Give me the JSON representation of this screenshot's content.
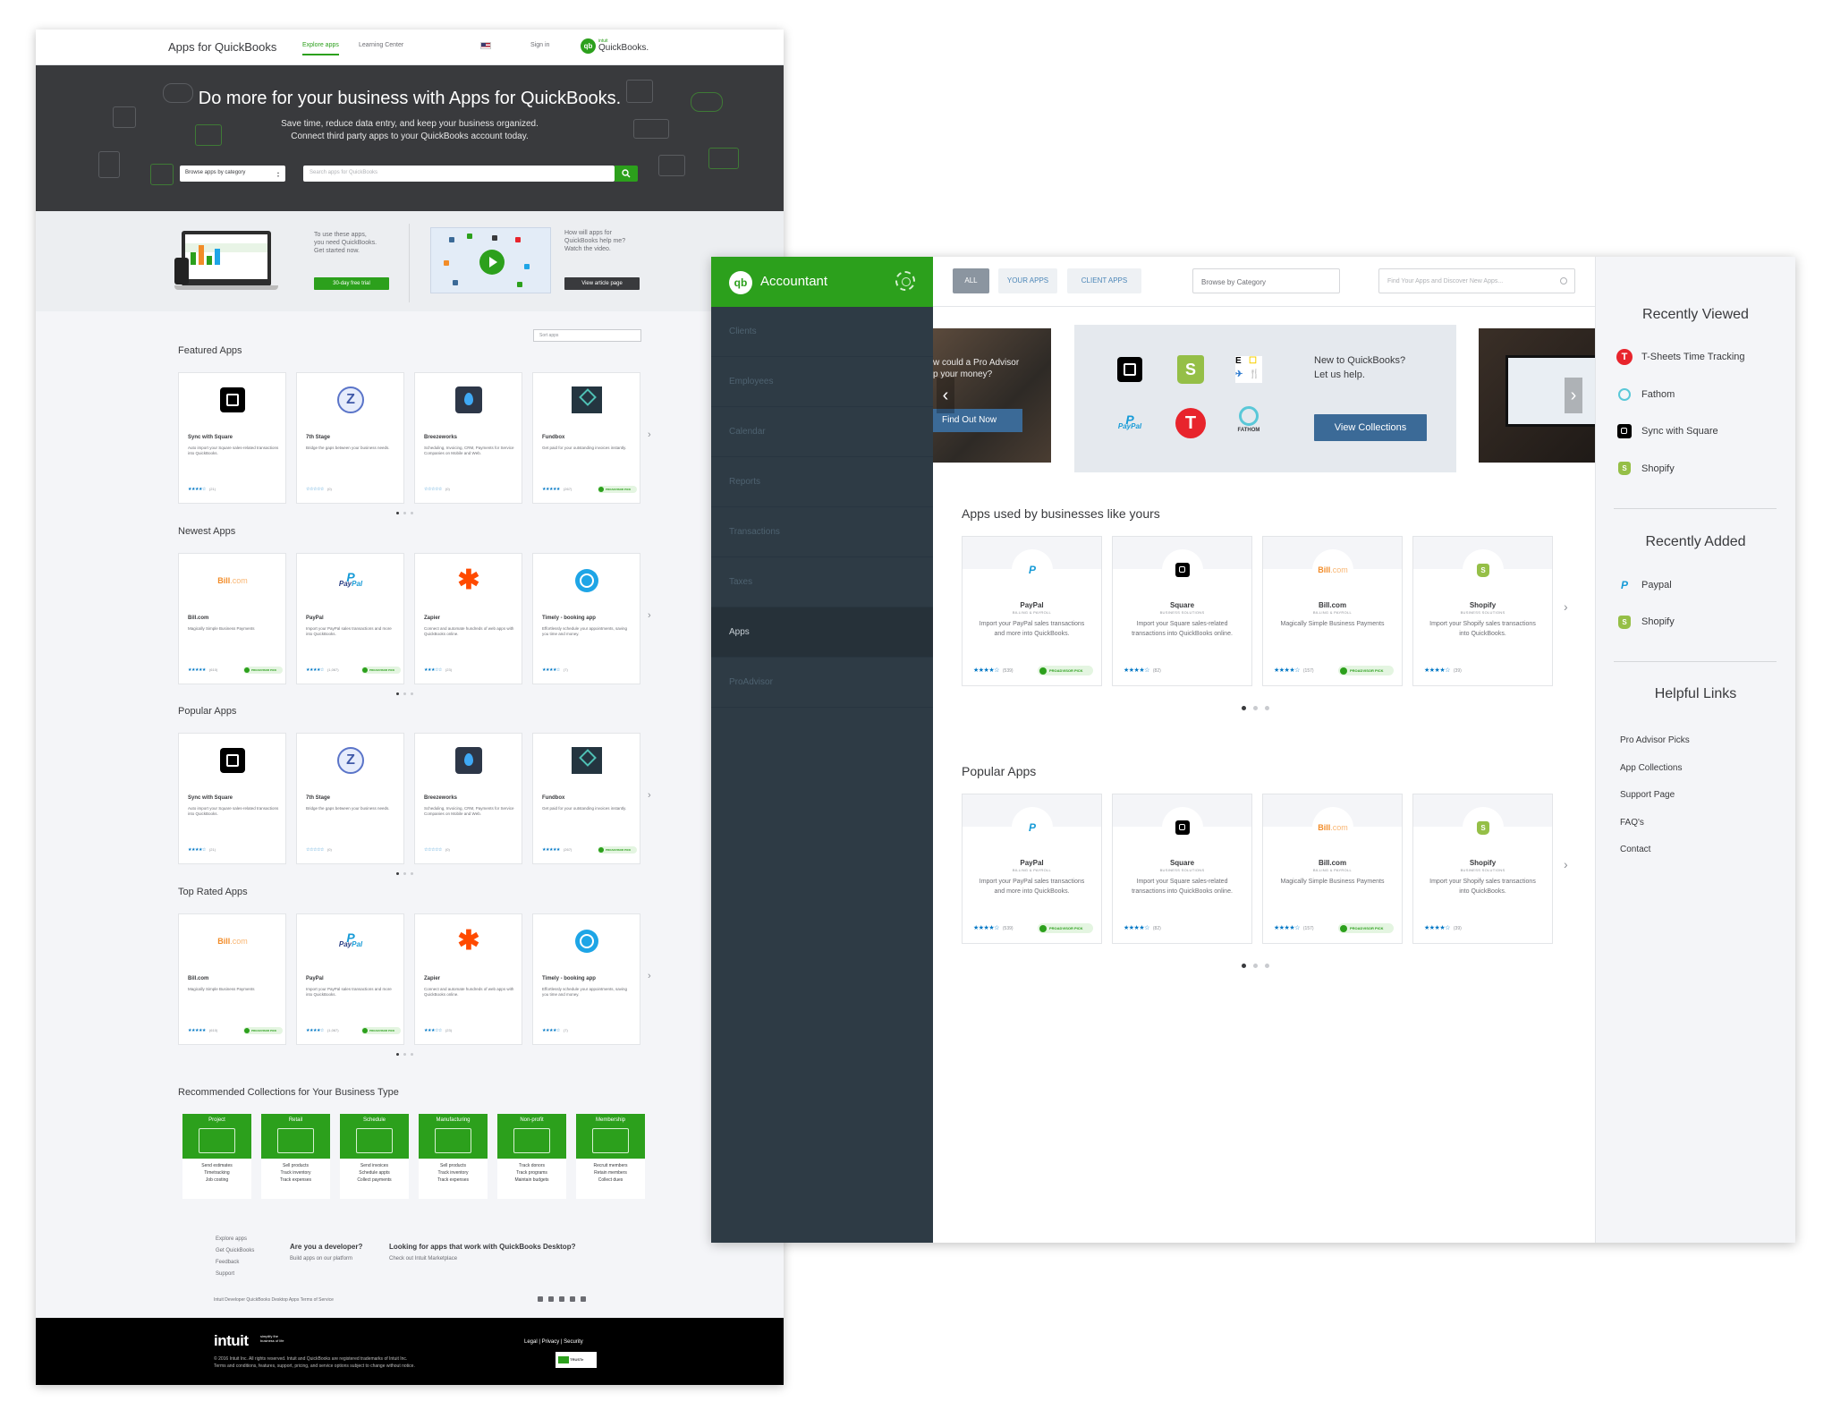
{
  "left": {
    "brand": "Apps for QuickBooks",
    "nav": [
      "Explore apps",
      "Learning Center"
    ],
    "sign_in": "Sign in",
    "qb_logo_top": "intuit",
    "qb_logo": "QuickBooks.",
    "hero": {
      "title": "Do more for your business with Apps for QuickBooks.",
      "subtitle_1": "Save time, reduce data entry, and keep your business organized.",
      "subtitle_2": "Connect third party apps to your QuickBooks account today.",
      "category_select": "Browse apps by category",
      "search_placeholder": "Search apps for QuickBooks"
    },
    "promo": {
      "text_1": "To use these apps,",
      "text_2": "you need QuickBooks.",
      "text_3": "Get started now.",
      "trial_button": "30-day free trial",
      "video_text_1": "How will apps for",
      "video_text_2": "QuickBooks help me?",
      "video_text_3": "Watch the video.",
      "article_button": "View article page"
    },
    "sort_select": "Sort apps",
    "pa_pill": "PROADVISOR PICK",
    "sections": [
      {
        "title": "Featured Apps",
        "cards": [
          {
            "name": "Sync with Square",
            "desc": "Auto import your Square sales-related transactions into QuickBooks.",
            "stars": "★★★★☆",
            "count": "(21)",
            "logo": "square-logo",
            "pa": false
          },
          {
            "name": "7th Stage",
            "desc": "Bridge the gaps between your business needs.",
            "stars": "☆☆☆☆☆",
            "count": "(0)",
            "logo": "seventh-stage-logo",
            "pa": false
          },
          {
            "name": "Breezeworks",
            "desc": "Scheduling, Invoicing, CRM, Payments for Service Companies on Mobile and Web.",
            "stars": "☆☆☆☆☆",
            "count": "(0)",
            "logo": "breezeworks-logo",
            "pa": false
          },
          {
            "name": "Fundbox",
            "desc": "Get paid for your outstanding invoices instantly.",
            "stars": "★★★★★",
            "count": "(267)",
            "logo": "fundbox-logo",
            "pa": true
          }
        ]
      },
      {
        "title": "Newest Apps",
        "cards": [
          {
            "name": "Bill.com",
            "desc": "Magically Simple Business Payments",
            "stars": "★★★★★",
            "count": "(610)",
            "logo": "billcom-logo",
            "pa": true
          },
          {
            "name": "PayPal",
            "desc": "Import your PayPal sales transactions and more into QuickBooks.",
            "stars": "★★★★☆",
            "count": "(1,067)",
            "logo": "paypal-logo",
            "pa": true
          },
          {
            "name": "Zapier",
            "desc": "Connect and automate hundreds of web apps with QuickBooks online.",
            "stars": "★★★☆☆",
            "count": "(23)",
            "logo": "zapier-logo",
            "pa": false
          },
          {
            "name": "Timely - booking app",
            "desc": "Effortlessly schedule your appointments, saving you time and money.",
            "stars": "★★★★☆",
            "count": "(7)",
            "logo": "timely-logo",
            "pa": false
          }
        ]
      },
      {
        "title": "Popular Apps",
        "cards": [
          {
            "name": "Sync with Square",
            "desc": "Auto import your Square sales-related transactions into QuickBooks.",
            "stars": "★★★★☆",
            "count": "(21)",
            "logo": "square-logo",
            "pa": false
          },
          {
            "name": "7th Stage",
            "desc": "Bridge the gaps between your business needs.",
            "stars": "☆☆☆☆☆",
            "count": "(0)",
            "logo": "seventh-stage-logo",
            "pa": false
          },
          {
            "name": "Breezeworks",
            "desc": "Scheduling, Invoicing, CRM, Payments for Service Companies on Mobile and Web.",
            "stars": "☆☆☆☆☆",
            "count": "(0)",
            "logo": "breezeworks-logo",
            "pa": false
          },
          {
            "name": "Fundbox",
            "desc": "Get paid for your outstanding invoices instantly.",
            "stars": "★★★★★",
            "count": "(267)",
            "logo": "fundbox-logo",
            "pa": true
          }
        ]
      },
      {
        "title": "Top Rated Apps",
        "cards": [
          {
            "name": "Bill.com",
            "desc": "Magically Simple Business Payments",
            "stars": "★★★★★",
            "count": "(610)",
            "logo": "billcom-logo",
            "pa": true
          },
          {
            "name": "PayPal",
            "desc": "Import your PayPal sales transactions and more into QuickBooks.",
            "stars": "★★★★☆",
            "count": "(1,067)",
            "logo": "paypal-logo",
            "pa": true
          },
          {
            "name": "Zapier",
            "desc": "Connect and automate hundreds of web apps with QuickBooks online.",
            "stars": "★★★☆☆",
            "count": "(23)",
            "logo": "zapier-logo",
            "pa": false
          },
          {
            "name": "Timely - booking app",
            "desc": "Effortlessly schedule your appointments, saving you time and money.",
            "stars": "★★★★☆",
            "count": "(7)",
            "logo": "timely-logo",
            "pa": false
          }
        ]
      }
    ],
    "collections_title": "Recommended Collections for Your Business Type",
    "collections": [
      {
        "label": "Project",
        "lines": [
          "Send estimates",
          "Timetracking",
          "Job costing"
        ]
      },
      {
        "label": "Retail",
        "lines": [
          "Sell products",
          "Track inventory",
          "Track expenses"
        ]
      },
      {
        "label": "Schedule",
        "lines": [
          "Send invoices",
          "Schedule appts",
          "Collect payments"
        ]
      },
      {
        "label": "Manufacturing",
        "lines": [
          "Sell products",
          "Track inventory",
          "Track expenses"
        ]
      },
      {
        "label": "Non-profit",
        "lines": [
          "Track donors",
          "Track programs",
          "Maintain budgets"
        ]
      },
      {
        "label": "Membership",
        "lines": [
          "Recruit members",
          "Retain members",
          "Collect dues"
        ]
      }
    ],
    "footer": {
      "links": [
        "Explore apps",
        "Get QuickBooks",
        "Feedback",
        "Support"
      ],
      "dev_heading": "Are you a developer?",
      "dev_sub": "Build apps on our platform",
      "desktop_heading": "Looking for apps that work with QuickBooks Desktop?",
      "desktop_sub": "Check out Intuit Marketplace",
      "bottom_links": "Intuit Developer    QuickBooks Desktop Apps    Terms of Service",
      "intuit": "intuit",
      "tagline_1": "simplify the",
      "tagline_2": "business of life",
      "copyright_1": "© 2016 Intuit Inc. All rights reserved. Intuit and QuickBooks are registered trademarks of Intuit Inc.",
      "copyright_2": "Terms and conditions, features, support, pricing, and service options subject to change without notice.",
      "legal": "Legal  |  Privacy  |  Security",
      "truste": "TRUSTe"
    }
  },
  "right": {
    "sidebar_title": "Accountant",
    "qb_mark": "qb",
    "nav": [
      "Clients",
      "Employees",
      "Calendar",
      "Reports",
      "Transactions",
      "Taxes",
      "Apps",
      "ProAdvisor"
    ],
    "tabs": [
      "ALL",
      "YOUR APPS",
      "CLIENT APPS"
    ],
    "category_select": "Browse by Category",
    "search_placeholder": "Find Your Apps and Discover New Apps...",
    "carousel": {
      "left_text_1": "w could a Pro Advisor",
      "left_text_2": "p your money?",
      "left_button": "Find Out Now",
      "center_text_1": "New to QuickBooks?",
      "center_text_2": "Let us help.",
      "center_button": "View Collections",
      "logo_paypal": "PayPal",
      "logo_fathom": "FATHOM",
      "logo_shopify": "S",
      "logo_tsheets": "T",
      "logo_expensify": [
        "E",
        "☐",
        "✈",
        "🍴"
      ]
    },
    "pill": "PROADVISOR PICK",
    "sections": [
      {
        "title": "Apps used by businesses like yours",
        "cards": [
          {
            "name": "PayPal",
            "cat": "BILLING & PAYROLL",
            "desc": "Import your PayPal sales transactions and more into QuickBooks.",
            "stars": "★★★★☆",
            "count": "(539)",
            "logo": "paypal-logo",
            "pa": true
          },
          {
            "name": "Square",
            "cat": "BUSINESS SOLUTIONS",
            "desc": "Import your Square sales-related transactions into QuickBooks online.",
            "stars": "★★★★☆",
            "count": "(82)",
            "logo": "square-logo",
            "pa": false
          },
          {
            "name": "Bill.com",
            "cat": "BILLING & PAYROLL",
            "desc": "Magically Simple Business Payments",
            "stars": "★★★★☆",
            "count": "(157)",
            "logo": "billcom-logo",
            "pa": true
          },
          {
            "name": "Shopify",
            "cat": "BUSINESS SOLUTIONS",
            "desc": "Import your Shopify sales transactions into QuickBooks.",
            "stars": "★★★★☆",
            "count": "(39)",
            "logo": "shopify-logo",
            "pa": false
          }
        ]
      },
      {
        "title": "Popular Apps",
        "cards": [
          {
            "name": "PayPal",
            "cat": "BILLING & PAYROLL",
            "desc": "Import your PayPal sales transactions and more into QuickBooks.",
            "stars": "★★★★☆",
            "count": "(539)",
            "logo": "paypal-logo",
            "pa": true
          },
          {
            "name": "Square",
            "cat": "BUSINESS SOLUTIONS",
            "desc": "Import your Square sales-related transactions into QuickBooks online.",
            "stars": "★★★★☆",
            "count": "(82)",
            "logo": "square-logo",
            "pa": false
          },
          {
            "name": "Bill.com",
            "cat": "BILLING & PAYROLL",
            "desc": "Magically Simple Business Payments",
            "stars": "★★★★☆",
            "count": "(157)",
            "logo": "billcom-logo",
            "pa": true
          },
          {
            "name": "Shopify",
            "cat": "BUSINESS SOLUTIONS",
            "desc": "Import your Shopify sales transactions into QuickBooks.",
            "stars": "★★★★☆",
            "count": "(39)",
            "logo": "shopify-logo",
            "pa": false
          }
        ]
      }
    ],
    "rail": {
      "recently_viewed_title": "Recently Viewed",
      "recently_viewed": [
        {
          "label": "T-Sheets Time Tracking",
          "logo": "tsheets-logo"
        },
        {
          "label": "Fathom",
          "logo": "fathom-logo"
        },
        {
          "label": "Sync with Square",
          "logo": "square-logo"
        },
        {
          "label": "Shopify",
          "logo": "shopify-logo"
        }
      ],
      "recently_added_title": "Recently Added",
      "recently_added": [
        {
          "label": "Paypal",
          "logo": "paypal-logo"
        },
        {
          "label": "Shopify",
          "logo": "shopify-logo"
        }
      ],
      "helpful_title": "Helpful Links",
      "helpful": [
        "Pro Advisor Picks",
        "App Collections",
        "Support Page",
        "FAQ's",
        "Contact"
      ]
    }
  }
}
